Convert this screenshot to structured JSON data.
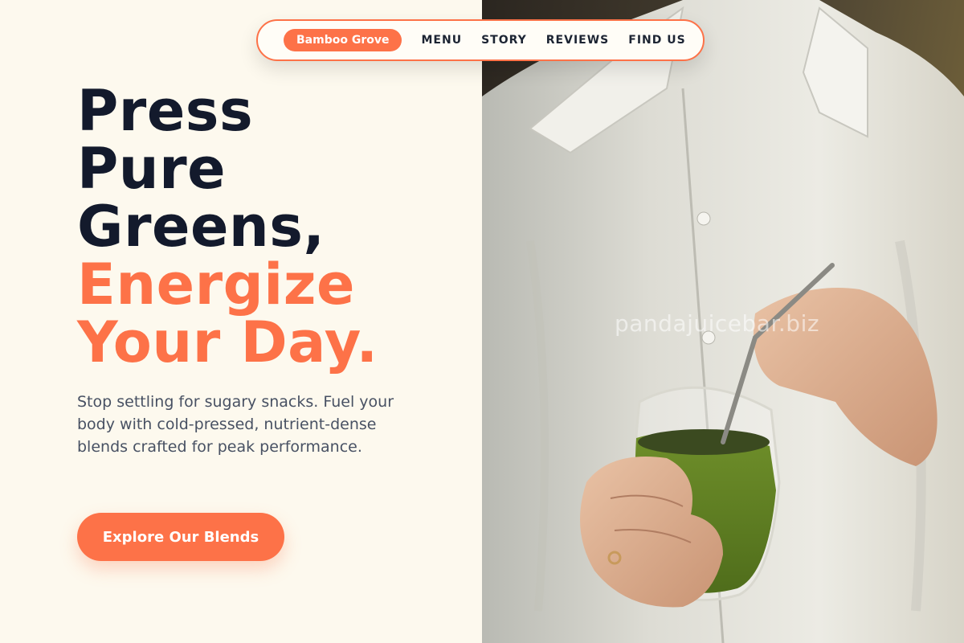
{
  "nav": {
    "brand": "Bamboo Grove",
    "links": [
      "MENU",
      "STORY",
      "REVIEWS",
      "FIND US"
    ]
  },
  "hero": {
    "headline_dark": [
      "Press",
      "Pure",
      "Greens,"
    ],
    "headline_accent": [
      "Energize",
      "Your Day."
    ],
    "subtext": "Stop settling for sugary snacks. Fuel your body with cold-pressed, nutrient-dense blends crafted for peak performance.",
    "cta_label": "Explore Our Blends"
  },
  "image": {
    "watermark": "pandajuicebar.biz"
  },
  "colors": {
    "accent": "#fd7248",
    "headline": "#131a2c",
    "background": "#fdf9ee",
    "body_text": "#485163"
  }
}
